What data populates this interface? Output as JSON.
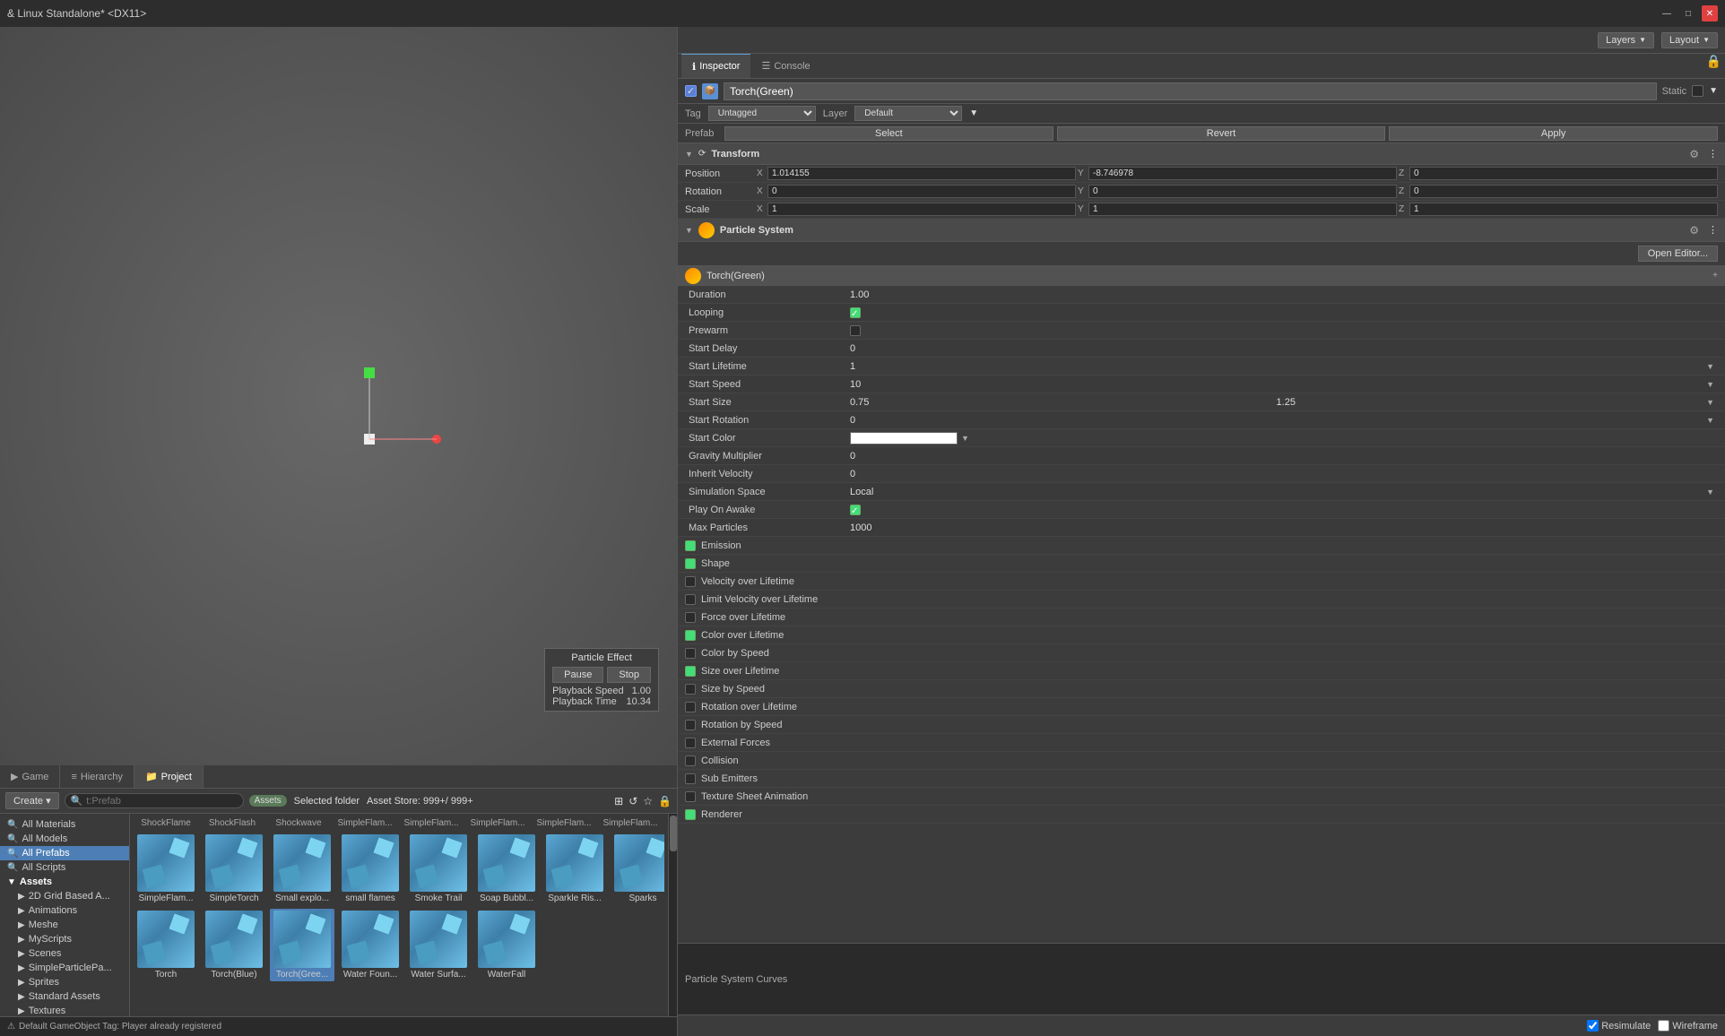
{
  "titleBar": {
    "title": "& Linux Standalone* <DX11>",
    "minimizeLabel": "—",
    "maximizeLabel": "□",
    "closeLabel": "✕"
  },
  "topToolbar": {
    "layersLabel": "Layers",
    "layoutLabel": "Layout"
  },
  "inspectorTabs": [
    {
      "id": "inspector",
      "label": "Inspector",
      "icon": "ℹ",
      "active": true
    },
    {
      "id": "console",
      "label": "Console",
      "icon": "☰",
      "active": false
    }
  ],
  "gameObject": {
    "enabled": true,
    "name": "Torch(Green)",
    "static": false,
    "tag": "Untagged",
    "layer": "Default"
  },
  "prefabButtons": [
    "Select",
    "Revert",
    "Apply"
  ],
  "transform": {
    "title": "Transform",
    "position": {
      "x": "1.014155",
      "y": "-8.746978",
      "z": "0"
    },
    "rotation": {
      "x": "0",
      "y": "0",
      "z": "0"
    },
    "scale": {
      "x": "1",
      "y": "1",
      "z": "1"
    }
  },
  "particleSystem": {
    "title": "Particle System",
    "openEditorLabel": "Open Editor...",
    "subsectionName": "Torch(Green)",
    "fields": [
      {
        "label": "Duration",
        "value": "1.00",
        "type": "number"
      },
      {
        "label": "Looping",
        "value": "check",
        "type": "checkbox"
      },
      {
        "label": "Prewarm",
        "value": "",
        "type": "checkbox-empty"
      },
      {
        "label": "Start Delay",
        "value": "0",
        "type": "number"
      },
      {
        "label": "Start Lifetime",
        "value": "1",
        "type": "number-dropdown"
      },
      {
        "label": "Start Speed",
        "value": "10",
        "type": "number-dropdown"
      },
      {
        "label": "Start Size",
        "value": "0.75",
        "value2": "1.25",
        "type": "dual-dropdown"
      },
      {
        "label": "Start Rotation",
        "value": "0",
        "type": "number-dropdown"
      },
      {
        "label": "Start Color",
        "value": "",
        "type": "color-dropdown"
      },
      {
        "label": "Gravity Multiplier",
        "value": "0",
        "type": "number"
      },
      {
        "label": "Inherit Velocity",
        "value": "0",
        "type": "number"
      },
      {
        "label": "Simulation Space",
        "value": "Local",
        "type": "dropdown-dropdown"
      },
      {
        "label": "Play On Awake",
        "value": "check",
        "type": "checkbox"
      },
      {
        "label": "Max Particles",
        "value": "1000",
        "type": "number"
      }
    ],
    "sections": [
      {
        "label": "Emission",
        "checked": true
      },
      {
        "label": "Shape",
        "checked": true
      },
      {
        "label": "Velocity over Lifetime",
        "checked": false
      },
      {
        "label": "Limit Velocity over Lifetime",
        "checked": false
      },
      {
        "label": "Force over Lifetime",
        "checked": false
      },
      {
        "label": "Color over Lifetime",
        "checked": true
      },
      {
        "label": "Color by Speed",
        "checked": false
      },
      {
        "label": "Size over Lifetime",
        "checked": true
      },
      {
        "label": "Size by Speed",
        "checked": false
      },
      {
        "label": "Rotation over Lifetime",
        "checked": false
      },
      {
        "label": "Rotation by Speed",
        "checked": false
      },
      {
        "label": "External Forces",
        "checked": false
      },
      {
        "label": "Collision",
        "checked": false
      },
      {
        "label": "Sub Emitters",
        "checked": false
      },
      {
        "label": "Texture Sheet Animation",
        "checked": false
      },
      {
        "label": "Renderer",
        "checked": true
      }
    ]
  },
  "particleCurves": {
    "title": "Particle System Curves"
  },
  "bottomControls": {
    "resimulateLabel": "Resimulate",
    "wireframeLabel": "Wireframe"
  },
  "viewportTabs": [
    {
      "label": "Game",
      "icon": "▶"
    },
    {
      "label": "Hierarchy",
      "icon": "≡"
    },
    {
      "label": "Project",
      "icon": "📁",
      "active": true
    }
  ],
  "projectToolbar": {
    "createLabel": "Create ▾",
    "searchPlaceholder": "t:Prefab",
    "filterAssets": "Assets",
    "selectedFolder": "Selected folder",
    "assetStore": "Asset Store: 999+/ 999+"
  },
  "folderTree": [
    {
      "label": "All Materials",
      "depth": 0
    },
    {
      "label": "All Models",
      "depth": 0
    },
    {
      "label": "All Prefabs",
      "depth": 0,
      "selected": true
    },
    {
      "label": "All Scripts",
      "depth": 0
    },
    {
      "label": "Assets",
      "depth": 0,
      "bold": true
    },
    {
      "label": "2D Grid Based A...",
      "depth": 1
    },
    {
      "label": "Animations",
      "depth": 1
    },
    {
      "label": "Meshe",
      "depth": 1
    },
    {
      "label": "MyScripts",
      "depth": 1
    },
    {
      "label": "Scenes",
      "depth": 1
    },
    {
      "label": "SimpleParticlePa...",
      "depth": 1
    },
    {
      "label": "Sprites",
      "depth": 1
    },
    {
      "label": "Standard Assets",
      "depth": 1
    },
    {
      "label": "Textures",
      "depth": 1
    }
  ],
  "assetLabels": [
    "ShockFlame",
    "ShockFlash",
    "Shockwave",
    "SimpleFlam...",
    "SimpleFlam...",
    "SimpleFlam...",
    "SimpleFlam...",
    "SimpleFlam..."
  ],
  "assets": [
    {
      "name": "SimpleFlam...",
      "type": "prefab"
    },
    {
      "name": "SimpleTorch",
      "type": "prefab"
    },
    {
      "name": "Small explo...",
      "type": "prefab"
    },
    {
      "name": "small flames",
      "type": "prefab"
    },
    {
      "name": "Smoke Trail",
      "type": "prefab"
    },
    {
      "name": "Soap Bubbl...",
      "type": "prefab"
    },
    {
      "name": "Sparkle Ris...",
      "type": "prefab"
    },
    {
      "name": "Sparks",
      "type": "prefab"
    },
    {
      "name": "Sparks",
      "type": "prefab"
    },
    {
      "name": "Torch",
      "type": "prefab"
    },
    {
      "name": "Torch(Blue)",
      "type": "prefab"
    },
    {
      "name": "Torch(Gree...",
      "type": "prefab",
      "selected": true
    },
    {
      "name": "Water Foun...",
      "type": "prefab"
    },
    {
      "name": "Water Surfa...",
      "type": "prefab"
    },
    {
      "name": "WaterFall",
      "type": "prefab"
    }
  ],
  "particleEffectPanel": {
    "title": "Particle Effect",
    "pauseLabel": "Pause",
    "stopLabel": "Stop",
    "playbackSpeedLabel": "Playback Speed",
    "playbackSpeedValue": "1.00",
    "playbackTimeLabel": "Playback Time",
    "playbackTimeValue": "10.34"
  },
  "statusBar": {
    "message": "Default GameObject Tag: Player already registered"
  }
}
